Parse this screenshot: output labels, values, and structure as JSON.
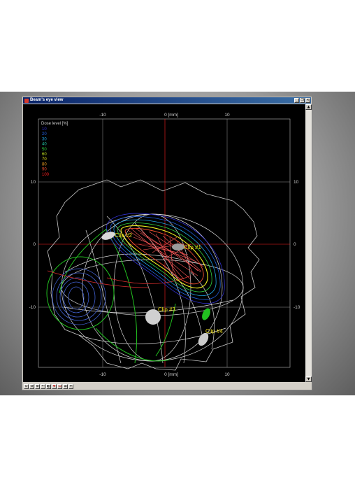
{
  "window": {
    "title": "Beam's eye view",
    "buttons": [
      "_",
      "❐",
      "✕"
    ]
  },
  "viewport": {
    "axis_tick_labels": {
      "top": [
        "-10",
        "0 [mm]",
        "10"
      ],
      "bottom": [
        "-10",
        "0 [mm]",
        "10"
      ],
      "left": [
        "10",
        "0",
        "-10"
      ],
      "right": [
        "10",
        "0",
        "-10"
      ]
    },
    "legend": {
      "title": "Dose level [%]",
      "levels": [
        {
          "label": "10",
          "color": "#3030d0"
        },
        {
          "label": "20",
          "color": "#2060e0"
        },
        {
          "label": "30",
          "color": "#20a0e0"
        },
        {
          "label": "40",
          "color": "#20c0a0"
        },
        {
          "label": "50",
          "color": "#30d040"
        },
        {
          "label": "60",
          "color": "#c0e020"
        },
        {
          "label": "70",
          "color": "#f0f020"
        },
        {
          "label": "80",
          "color": "#f0a020"
        },
        {
          "label": "90",
          "color": "#f05030"
        },
        {
          "label": "100",
          "color": "#ff2020"
        }
      ]
    },
    "clips": [
      "Clip #1",
      "Clip #2",
      "Clip #3",
      "Clip #4"
    ]
  },
  "scrollbar": {
    "up": "▲",
    "down": "▼"
  },
  "toolbar": {
    "tools": [
      "⊙",
      "⊖",
      "⊕",
      "↶",
      "◐",
      "✥",
      "⊡",
      "⊞",
      "▾"
    ]
  }
}
